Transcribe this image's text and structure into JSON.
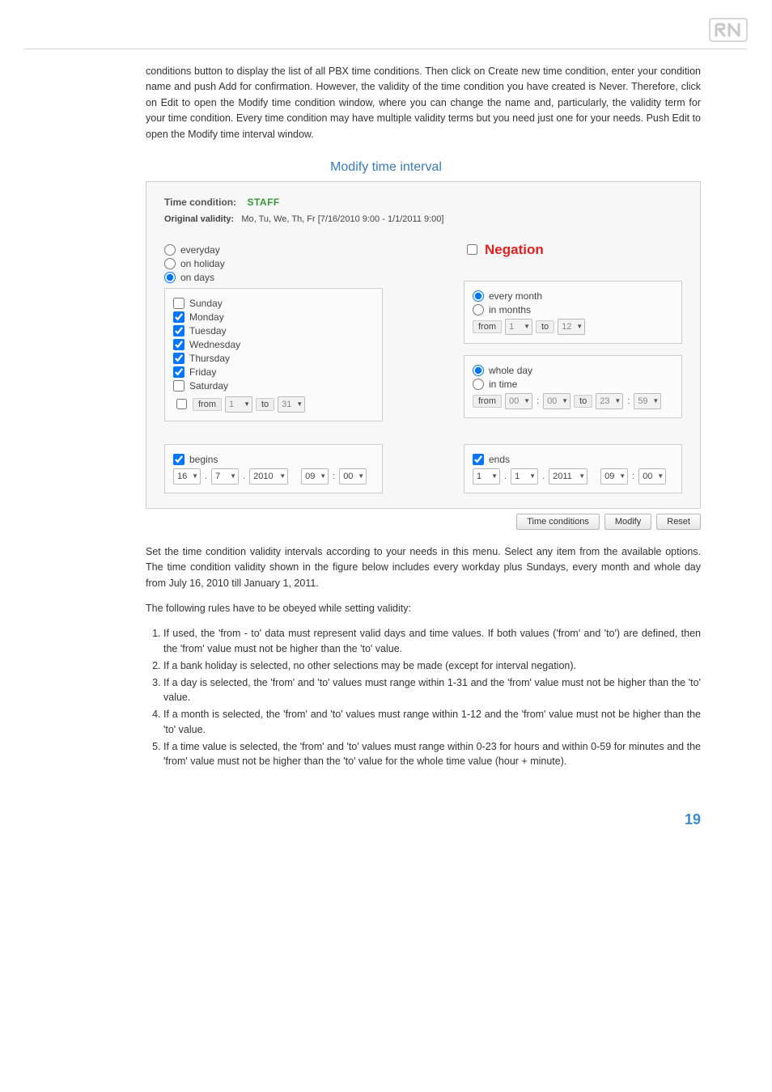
{
  "brand": {
    "icon_name": "brand-logo-icon"
  },
  "paragraphs": {
    "intro": "conditions button to display the list of all PBX time conditions. Then click on Create new time condition, enter your condition name and push Add for confirmation. However, the validity of the time condition you have created is Never. Therefore, click on Edit to open the Modify time condition window, where you can change the name and, particularly, the validity term for your time condition. Every time condition may have multiple validity terms but you need just one for your needs. Push Edit to open the Modify time interval window.",
    "after_modal": "Set the time condition validity intervals according to your needs in this menu. Select any item from the available options. The time condition validity shown in the figure below includes every workday plus Sundays, every month and whole day from July 16, 2010 till January 1, 2011.",
    "rules_intro": "The following rules have to be obeyed while setting validity:"
  },
  "modal": {
    "title": "Modify time interval",
    "tc_label": "Time condition:",
    "tc_name": "STAFF",
    "ov_label": "Original validity:",
    "ov_value": "Mo, Tu, We, Th, Fr  [7/16/2010 9:00 - 1/1/2011 9:00]",
    "radios": {
      "everyday": "everyday",
      "on_holiday": "on holiday",
      "on_days": "on days"
    },
    "negation_label": "Negation",
    "days": {
      "sunday": "Sunday",
      "monday": "Monday",
      "tuesday": "Tuesday",
      "wednesday": "Wednesday",
      "thursday": "Thursday",
      "friday": "Friday",
      "saturday": "Saturday"
    },
    "months": {
      "every_month": "every month",
      "in_months": "in months"
    },
    "day_time": {
      "whole_day": "whole day",
      "in_time": "in time"
    },
    "labels": {
      "from": "from",
      "to": "to",
      "begins": "begins",
      "ends": "ends"
    },
    "values": {
      "days_from": "1",
      "days_to": "31",
      "months_from": "1",
      "months_to": "12",
      "time_from_h": "00",
      "time_from_m": "00",
      "time_to_h": "23",
      "time_to_m": "59",
      "begins_d": "16",
      "begins_m": "7",
      "begins_y": "2010",
      "begins_h": "09",
      "begins_min": "00",
      "ends_d": "1",
      "ends_m": "1",
      "ends_y": "2011",
      "ends_h": "09",
      "ends_min": "00"
    },
    "buttons": {
      "time_conditions": "Time conditions",
      "modify": "Modify",
      "reset": "Reset"
    }
  },
  "rules": [
    "If used, the 'from - to' data must represent valid days and time values. If both values ('from' and 'to') are defined, then the 'from' value must not be higher than the 'to' value.",
    "If a bank holiday is selected, no other selections may be made (except for interval negation).",
    "If a day is selected, the 'from' and 'to' values must range within 1-31 and the 'from' value must not be higher than the 'to' value.",
    "If a month is selected, the 'from' and 'to' values must range within 1-12 and the 'from' value must not be higher than the 'to' value.",
    "If a time value is selected, the 'from' and 'to' values must range within 0-23 for hours and within 0-59 for minutes and the 'from' value must not be higher than the 'to' value for the whole time value (hour + minute)."
  ],
  "page_number": "19"
}
